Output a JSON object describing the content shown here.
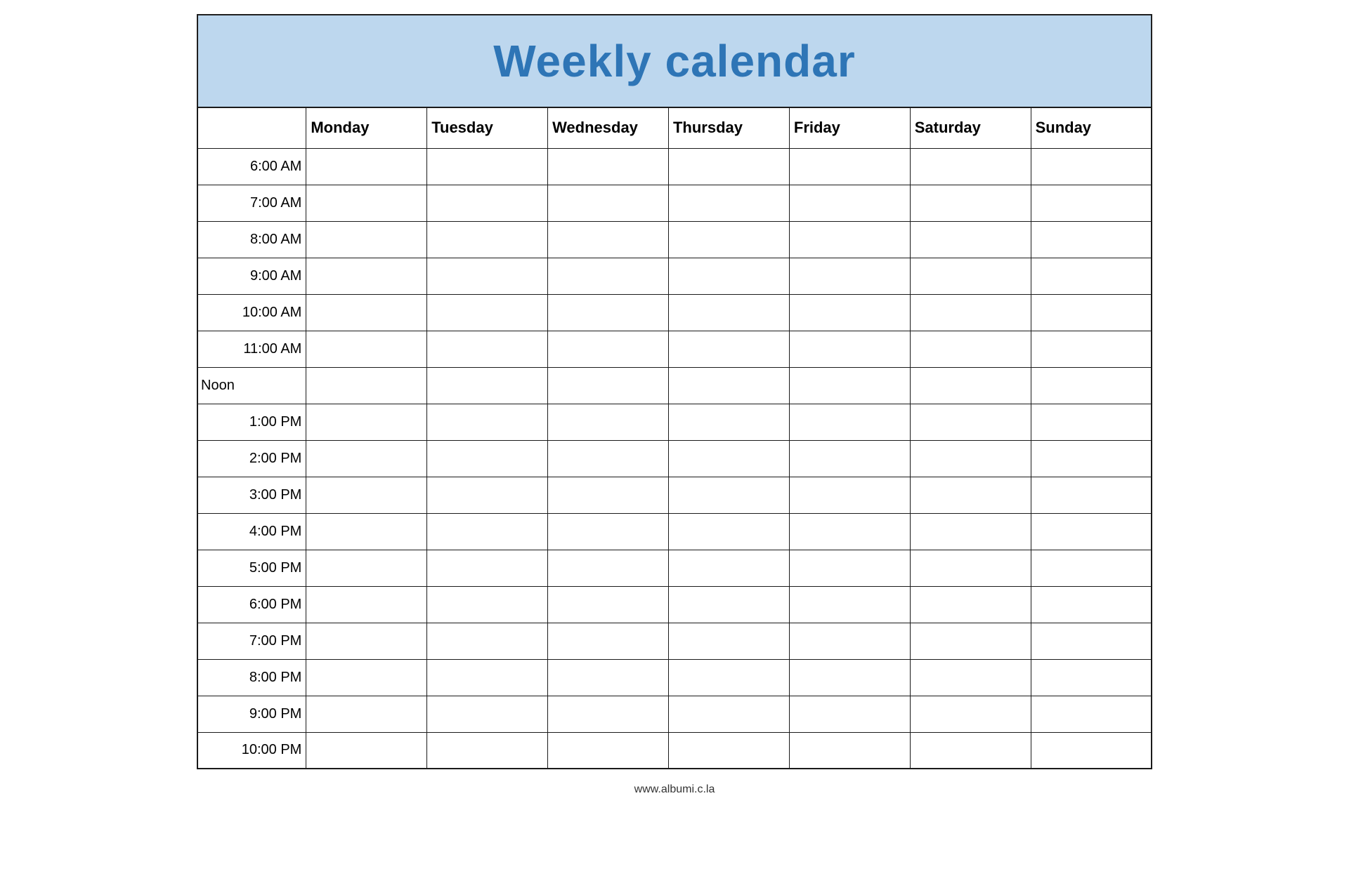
{
  "title": "Weekly calendar",
  "header": {
    "days": [
      "",
      "Monday",
      "Tuesday",
      "Wednesday",
      "Thursday",
      "Friday",
      "Saturday",
      "Sunday"
    ]
  },
  "time_slots": [
    "6:00 AM",
    "7:00 AM",
    "8:00 AM",
    "9:00 AM",
    "10:00 AM",
    "11:00 AM",
    "Noon",
    "1:00 PM",
    "2:00 PM",
    "3:00 PM",
    "4:00 PM",
    "5:00 PM",
    "6:00 PM",
    "7:00 PM",
    "8:00 PM",
    "9:00 PM",
    "10:00 PM"
  ],
  "footer": "www.albumi.c.la",
  "colors": {
    "title_bg": "#bdd7ee",
    "title_text": "#2e75b6",
    "border": "#1a1a1a"
  }
}
